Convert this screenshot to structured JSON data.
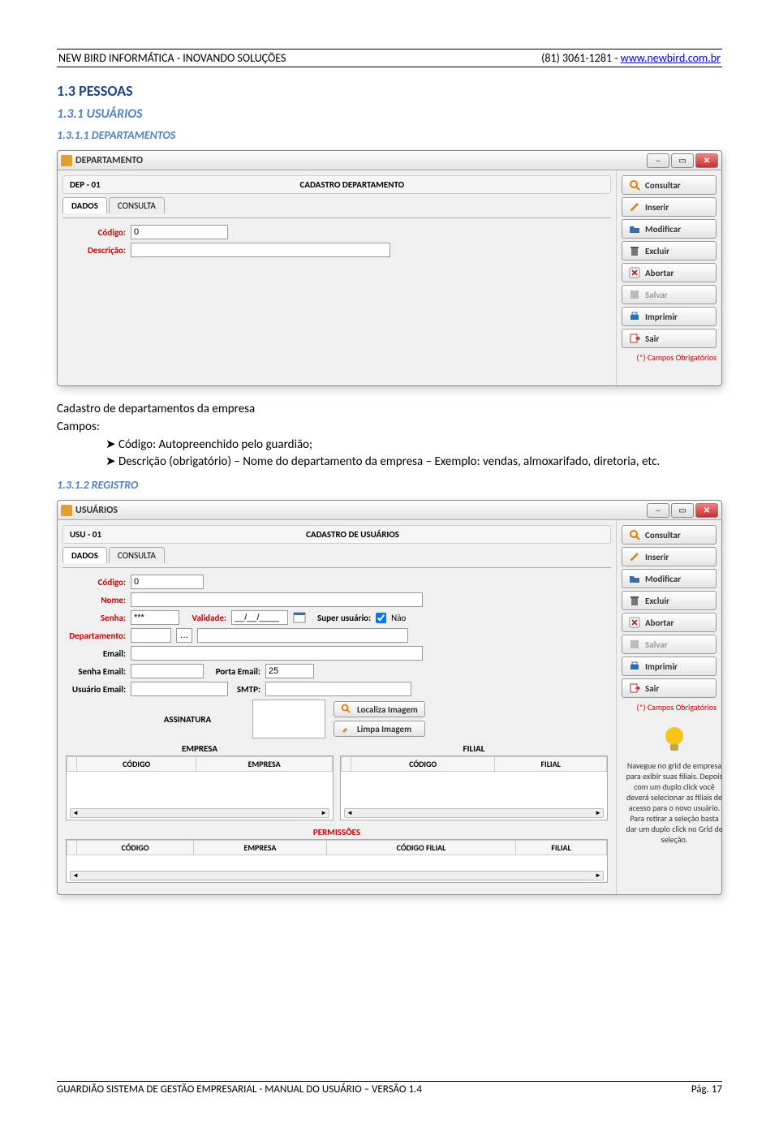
{
  "header": {
    "left": "NEW BIRD INFORMÁTICA - INOVANDO SOLUÇÕES",
    "phone": "(81) 3061-1281 - ",
    "link": "www.newbird.com.br"
  },
  "section1": "1.3 PESSOAS",
  "section2": "1.3.1 USUÁRIOS",
  "section3": "1.3.1.1 DEPARTAMENTOS",
  "section4": "1.3.1.2 REGISTRO",
  "body_text": {
    "line1": "Cadastro de departamentos da empresa",
    "line2": "Campos:",
    "bullet1": "Código: Autopreenchido pelo guardião;",
    "bullet2": "Descrição (obrigatório) – Nome do departamento da empresa – Exemplo: vendas, almoxarifado, diretoria, etc."
  },
  "win1": {
    "title": "DEPARTAMENTO",
    "code_label": "DEP - 01",
    "heading": "CADASTRO DEPARTAMENTO",
    "tab_dados": "DADOS",
    "tab_consulta": "CONSULTA",
    "lbl_codigo": "Código:",
    "lbl_descricao": "Descrição:",
    "val_codigo": "0",
    "buttons": [
      "Consultar",
      "Inserir",
      "Modificar",
      "Excluir",
      "Abortar",
      "Salvar",
      "Imprimir",
      "Sair"
    ],
    "obrig": "(*) Campos Obrigatórios"
  },
  "win2": {
    "title": "USUÁRIOS",
    "code_label": "USU - 01",
    "heading": "CADASTRO DE USUÁRIOS",
    "tab_dados": "DADOS",
    "tab_consulta": "CONSULTA",
    "lbl_codigo": "Código:",
    "val_codigo": "0",
    "lbl_nome": "Nome:",
    "lbl_senha": "Senha:",
    "val_senha": "***",
    "lbl_validade": "Validade:",
    "val_validade": "__/__/____",
    "lbl_super": "Super usuário:",
    "chk_super": "Não",
    "lbl_depto": "Departamento:",
    "lbl_email": "Email:",
    "lbl_senha_email": "Senha Email:",
    "lbl_porta": "Porta Email:",
    "val_porta": "25",
    "lbl_usuario_email": "Usuário Email:",
    "lbl_smtp": "SMTP:",
    "assinatura": "ASSINATURA",
    "btn_localiza": "Localiza Imagem",
    "btn_limpa": "Limpa Imagem",
    "grid_empresa": "EMPRESA",
    "grid_filial": "FILIAL",
    "col_codigo": "CÓDIGO",
    "col_empresa": "EMPRESA",
    "col_filial": "FILIAL",
    "col_codfilial": "CÓDIGO FILIAL",
    "permissoes": "PERMISSÕES",
    "buttons": [
      "Consultar",
      "Inserir",
      "Modificar",
      "Excluir",
      "Abortar",
      "Salvar",
      "Imprimir",
      "Sair"
    ],
    "obrig": "(*) Campos Obrigatórios",
    "tip": "Navegue no grid de empresa para exibir suas filiais. Depois com um duplo click você deverá selecionar as filiais de acesso para o novo usuário. Para retirar a seleção basta dar um duplo click no Grid de seleção."
  },
  "footer": {
    "left": "GUARDIÃO SISTEMA DE GESTÃO EMPRESARIAL - MANUAL DO USUÁRIO – VERSÃO 1.4",
    "right": "Pág. 17"
  },
  "icons": {
    "consultar": "#e07b00",
    "inserir": "#d28b2a",
    "modificar": "#3a6ea5",
    "excluir": "#555",
    "abortar": "#b03030",
    "salvar": "#888",
    "imprimir": "#2a6fb0",
    "sair": "#b03030",
    "localiza": "#e07b00",
    "limpa": "#d28b2a",
    "bulb": "#f5c518"
  }
}
